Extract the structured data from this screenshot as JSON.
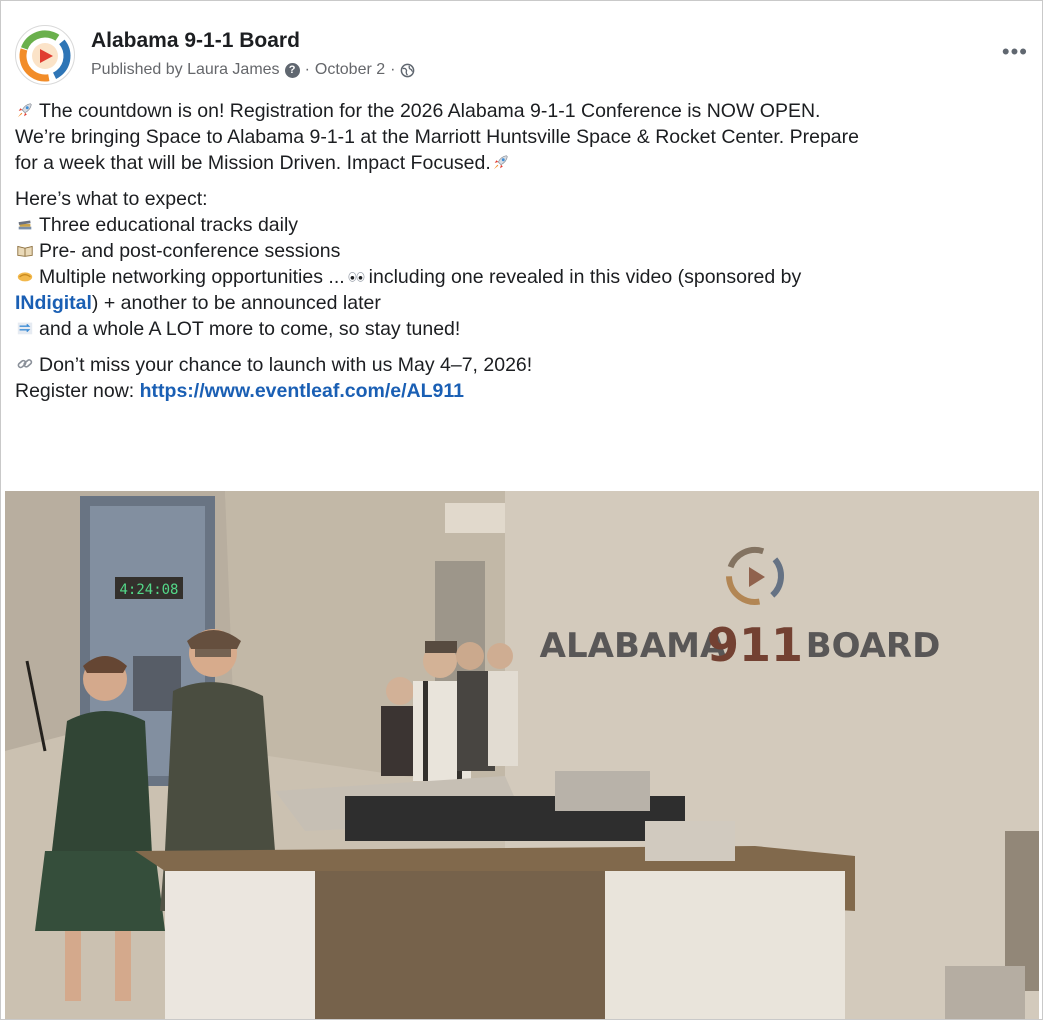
{
  "post": {
    "page_name": "Alabama 9-1-1 Board",
    "published_by": "Published by Laura James",
    "help_icon_glyph": "?",
    "date": "October 2",
    "separator": "·",
    "more_label": "•••",
    "paragraph1": {
      "line1": "The countdown is on! Registration for the 2026 Alabama 9-1-1 Conference is NOW OPEN.",
      "line2": "We’re bringing Space to Alabama 9-1-1 at the Marriott Huntsville Space & Rocket Center. Prepare",
      "line3": "for a week that will be Mission Driven. Impact Focused."
    },
    "paragraph2": {
      "intro": "Here’s what to expect:",
      "item1": "Three educational tracks daily",
      "item2": "Pre- and post-conference sessions",
      "item3_part1": "Multiple networking opportunities ...",
      "item3_part2": "including one revealed in this video (sponsored by",
      "item3_link": "INdigital",
      "item3_part3": ") + another to be announced later",
      "item4": "and a whole A LOT more to come, so stay tuned!"
    },
    "paragraph3": {
      "line1": "Don’t miss your chance to launch with us May 4–7, 2026!",
      "register_label": "Register now: ",
      "register_url": "https://www.eventleaf.com/e/AL911"
    },
    "icons": {
      "avatar": "alabama-911-logo-icon",
      "help": "help-circle-icon",
      "audience": "globe-icon",
      "rocket": "rocket-icon",
      "books": "books-icon",
      "open_book": "open-book-icon",
      "handshake": "handshake-icon",
      "eyes": "eyes-icon",
      "arrows": "arrows-icon",
      "link": "link-icon"
    },
    "video": {
      "clock_text": "4:24:08",
      "wall_sign_left": "ALABAMA",
      "wall_sign_number": "911",
      "wall_sign_right": "BOARD"
    },
    "colors": {
      "link": "#1a5fb4",
      "meta_text": "#65676b",
      "logo_orange": "#f28c28",
      "logo_blue": "#2e75b6",
      "logo_green": "#6ab04c",
      "logo_red": "#e03c31"
    }
  }
}
